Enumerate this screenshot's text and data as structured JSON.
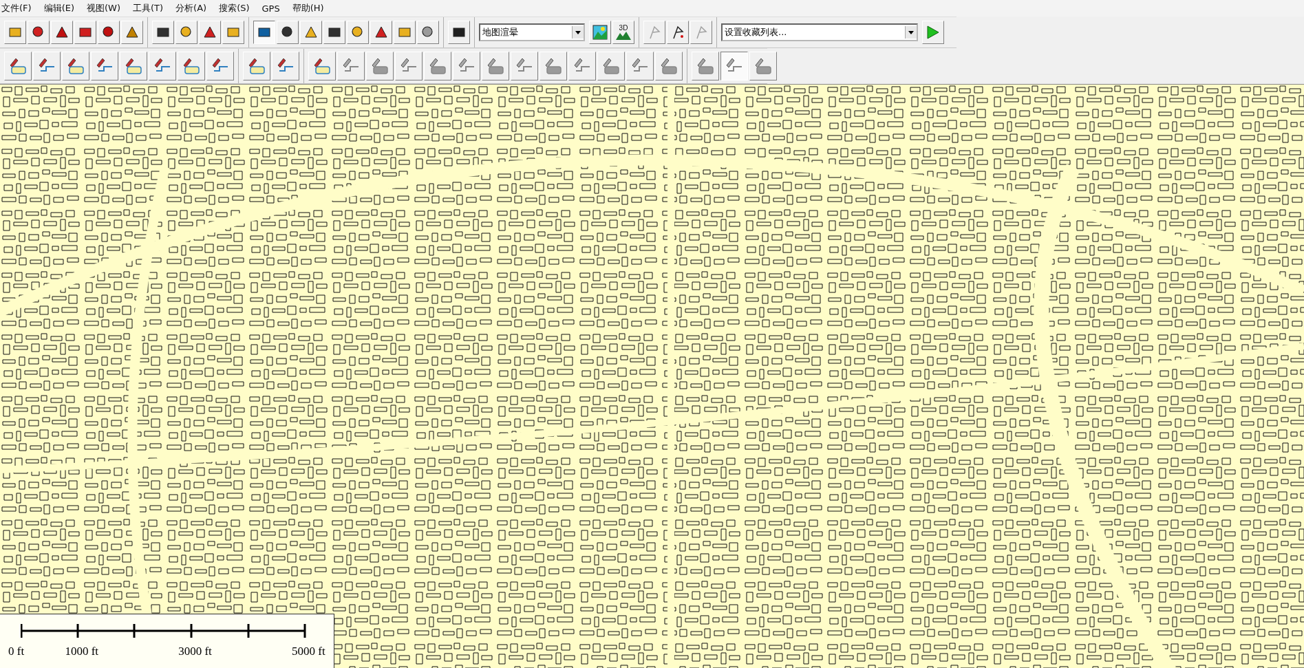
{
  "menu": [
    "文件(F)",
    "编辑(E)",
    "视图(W)",
    "工具(T)",
    "分析(A)",
    "搜索(S)",
    "GPS",
    "帮助(H)"
  ],
  "toolbar_1": {
    "groups": [
      [
        {
          "disabled": false,
          "pressed": false
        },
        {
          "disabled": false,
          "pressed": false
        },
        {
          "disabled": false,
          "pressed": false
        },
        {
          "disabled": false,
          "pressed": false
        },
        {
          "disabled": false,
          "pressed": false
        },
        {
          "disabled": false,
          "pressed": false
        }
      ],
      [
        {
          "disabled": false,
          "pressed": false
        },
        {
          "disabled": false,
          "pressed": false
        },
        {
          "disabled": false,
          "pressed": false
        },
        {
          "disabled": false,
          "pressed": false
        }
      ],
      [
        {
          "disabled": false,
          "pressed": true
        },
        {
          "disabled": false,
          "pressed": false
        },
        {
          "disabled": false,
          "pressed": false
        },
        {
          "disabled": false,
          "pressed": false
        },
        {
          "disabled": false,
          "pressed": false
        },
        {
          "disabled": false,
          "pressed": false
        },
        {
          "disabled": false,
          "pressed": false
        },
        {
          "disabled": true,
          "pressed": false
        }
      ],
      [
        {
          "disabled": false,
          "pressed": false
        }
      ]
    ],
    "render_combo": {
      "value": "地图渲晕"
    },
    "render_buttons": [
      {
        "disabled": false,
        "pressed": false
      },
      {
        "disabled": false,
        "pressed": false,
        "label": "3D"
      }
    ],
    "gps_buttons": [
      {
        "disabled": true,
        "pressed": false
      },
      {
        "disabled": false,
        "pressed": false
      },
      {
        "disabled": true,
        "pressed": false
      }
    ],
    "favorites_combo": {
      "value": "设置收藏列表..."
    },
    "go_button": {
      "disabled": false
    }
  },
  "toolbar_2": {
    "groups": [
      [
        {
          "disabled": false,
          "pressed": false
        },
        {
          "disabled": false,
          "pressed": false
        },
        {
          "disabled": false,
          "pressed": false
        },
        {
          "disabled": false,
          "pressed": false
        },
        {
          "disabled": false,
          "pressed": false
        },
        {
          "disabled": false,
          "pressed": false
        },
        {
          "disabled": false,
          "pressed": false
        },
        {
          "disabled": false,
          "pressed": false
        }
      ],
      [
        {
          "disabled": false,
          "pressed": false
        },
        {
          "disabled": false,
          "pressed": false
        }
      ],
      [
        {
          "disabled": false,
          "pressed": false
        },
        {
          "disabled": true,
          "pressed": false
        },
        {
          "disabled": true,
          "pressed": false
        },
        {
          "disabled": true,
          "pressed": false
        },
        {
          "disabled": true,
          "pressed": false
        },
        {
          "disabled": true,
          "pressed": false
        },
        {
          "disabled": true,
          "pressed": false
        },
        {
          "disabled": true,
          "pressed": false
        },
        {
          "disabled": true,
          "pressed": false
        },
        {
          "disabled": true,
          "pressed": false
        },
        {
          "disabled": true,
          "pressed": false
        },
        {
          "disabled": true,
          "pressed": false
        },
        {
          "disabled": true,
          "pressed": false
        }
      ],
      [
        {
          "disabled": true,
          "pressed": false
        },
        {
          "disabled": true,
          "pressed": true
        },
        {
          "disabled": true,
          "pressed": false
        }
      ]
    ]
  },
  "scale_bar": {
    "labels": [
      "0 ft",
      "1000 ft",
      "3000 ft",
      "5000 ft"
    ]
  }
}
